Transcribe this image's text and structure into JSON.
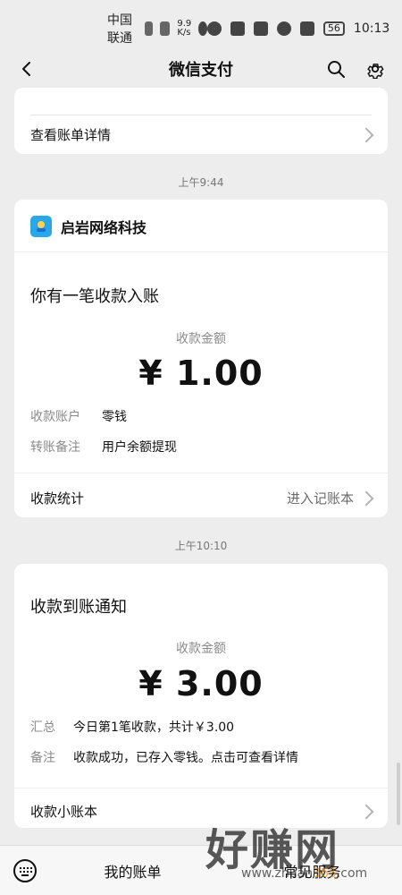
{
  "status": {
    "carrier": "中国联通",
    "hd": "HD",
    "network": "5G",
    "speed": "9.9\nK/s",
    "battery": "56",
    "time": "10:13"
  },
  "nav": {
    "title": "微信支付"
  },
  "top_card": {
    "link_label": "查看账单详情"
  },
  "msg1": {
    "time": "上午9:44",
    "merchant": "启岩网络科技",
    "headline": "你有一笔收款入账",
    "amount_label": "收款金额",
    "amount": "¥ 1.00",
    "rows": [
      {
        "key": "收款账户",
        "value": "零钱"
      },
      {
        "key": "转账备注",
        "value": "用户余额提现"
      }
    ],
    "footer_left": "收款统计",
    "footer_right": "进入记账本"
  },
  "msg2": {
    "time": "上午10:10",
    "headline": "收款到账通知",
    "amount_label": "收款金额",
    "amount": "¥ 3.00",
    "rows": [
      {
        "key": "汇总",
        "value": "今日第1笔收款，共计￥3.00"
      },
      {
        "key": "备注",
        "value": "收款成功，已存入零钱。点击可查看详情"
      }
    ],
    "footer_left": "收款小账本"
  },
  "bottom_nav": {
    "item1": "我的账单",
    "item2": "常见服务"
  },
  "watermark": {
    "title": "好赚网",
    "sub_a": "www.zhuan",
    "sub_b": "365",
    "sub_c": ".com"
  }
}
